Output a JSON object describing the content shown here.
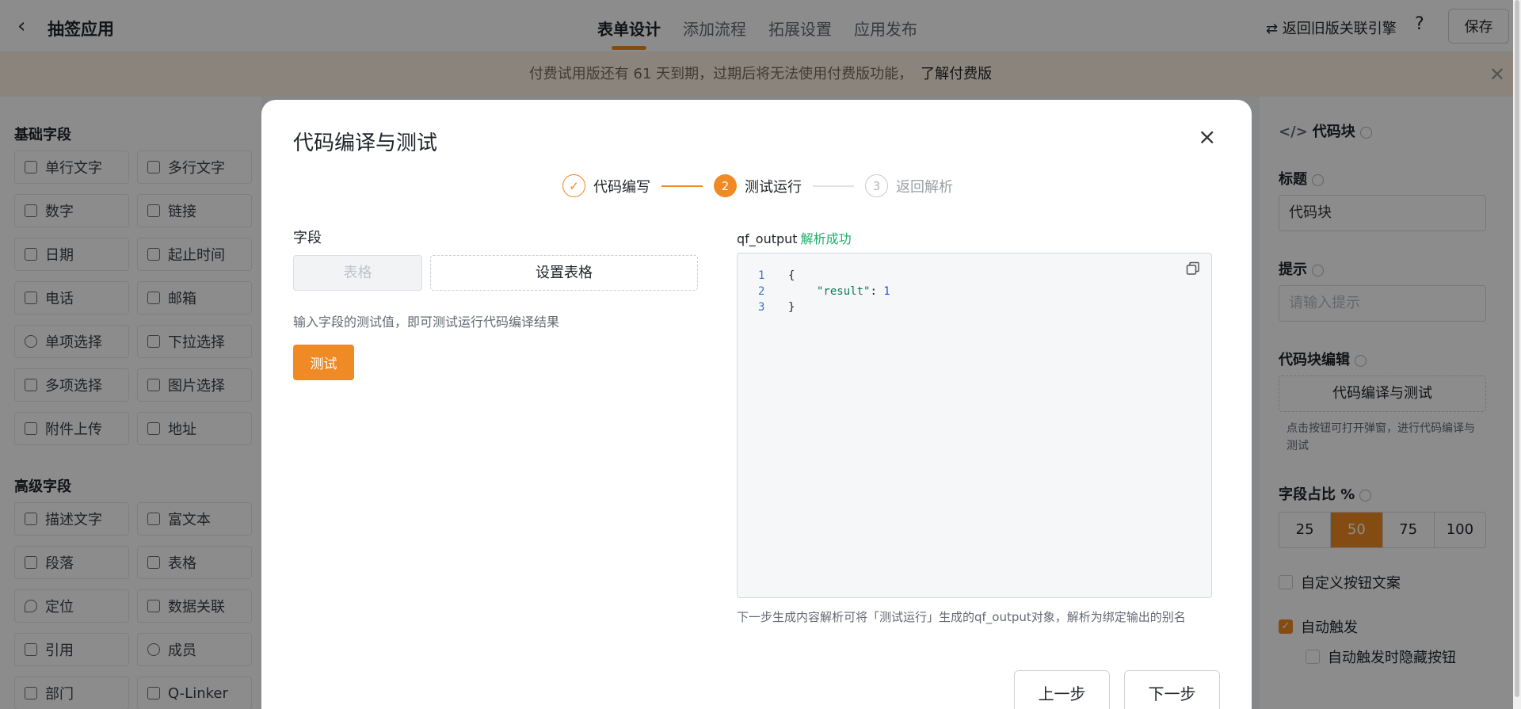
{
  "header": {
    "back_icon": "chevron-left-icon",
    "app_title": "抽签应用",
    "tabs": [
      "表单设计",
      "添加流程",
      "拓展设置",
      "应用发布"
    ],
    "active_tab": "表单设计",
    "legacy_link": "⇄ 返回旧版关联引擎",
    "help_icon": "question-icon",
    "save_label": "保存"
  },
  "banner": {
    "text": "付费试用版还有 61 天到期，过期后将无法使用付费版功能，",
    "link": "了解付费版",
    "close_icon": "close-icon"
  },
  "left_panel": {
    "basic_title": "基础字段",
    "basic_fields": [
      "单行文字",
      "多行文字",
      "数字",
      "链接",
      "日期",
      "起止时间",
      "电话",
      "邮箱",
      "单项选择",
      "下拉选择",
      "多项选择",
      "图片选择",
      "附件上传",
      "地址"
    ],
    "advanced_title": "高级字段",
    "advanced_fields": [
      "描述文字",
      "富文本",
      "段落",
      "表格",
      "定位",
      "数据关联",
      "引用",
      "成员",
      "部门",
      "Q-Linker"
    ]
  },
  "right_panel": {
    "heading": "代码块",
    "title_label": "标题",
    "title_value": "代码块",
    "hint_label": "提示",
    "hint_placeholder": "请输入提示",
    "edit_label": "代码块编辑",
    "edit_button": "代码编译与测试",
    "edit_note": "点击按钮可打开弹窗，进行代码编译与测试",
    "ratio_label": "字段占比 %",
    "ratio_options": [
      "25",
      "50",
      "75",
      "100"
    ],
    "ratio_selected": "50",
    "custom_button_text": "自定义按钮文案",
    "auto_trigger": "自动触发",
    "auto_trigger_checked": true,
    "hide_on_auto": "自动触发时隐藏按钮"
  },
  "modal": {
    "title": "代码编译与测试",
    "steps": [
      {
        "number": "✓",
        "label": "代码编写",
        "state": "done"
      },
      {
        "number": "2",
        "label": "测试运行",
        "state": "current"
      },
      {
        "number": "3",
        "label": "返回解析",
        "state": "todo"
      }
    ],
    "field_label": "字段",
    "table_button": "表格",
    "set_table_button": "设置表格",
    "hint": "输入字段的测试值，即可测试运行代码编译结果",
    "test_button": "测试",
    "output_label": "qf_output",
    "output_status": "解析成功",
    "code_lines": [
      {
        "no": "1",
        "text": "{"
      },
      {
        "no": "2",
        "key": "\"result\"",
        "sep": ": ",
        "value": "1"
      },
      {
        "no": "3",
        "text": "}"
      }
    ],
    "footnote": "下一步生成内容解析可将「测试运行」生成的qf_output对象，解析为绑定输出的别名",
    "prev_button": "上一步",
    "next_button": "下一步"
  },
  "colors": {
    "accent": "#f08a24",
    "success": "#16b06a"
  }
}
